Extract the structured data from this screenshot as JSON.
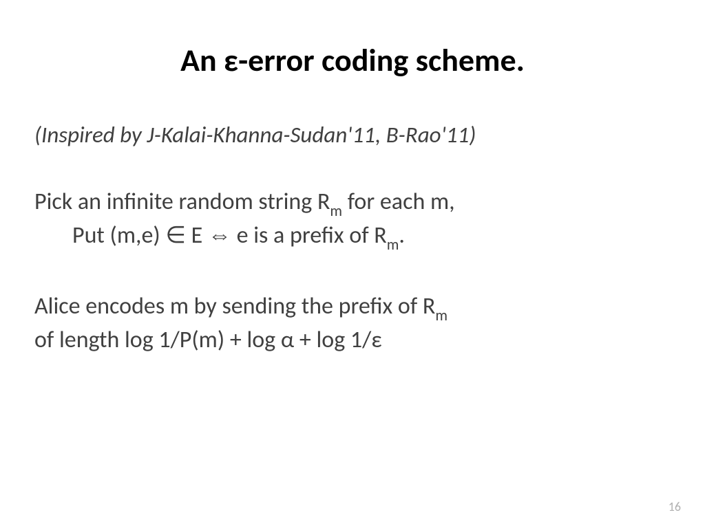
{
  "title": "An ε-error coding scheme.",
  "subtitle": "(Inspired by J-Kalai-Khanna-Sudan'11, B-Rao'11)",
  "para1_line1_pre": "Pick an infinite random string R",
  "para1_line1_sub": "m",
  "para1_line1_post": " for each m,",
  "para1_line2_pre": "Put (m,e) ∈ E  ⇔ e is a prefix of R",
  "para1_line2_sub": "m",
  "para1_line2_post": ".",
  "para2_line1_pre": "Alice encodes m by sending the prefix of R",
  "para2_line1_sub": "m",
  "para2_line2": "of length log 1/P(m) + log α + log 1/ε",
  "page_number": "16"
}
